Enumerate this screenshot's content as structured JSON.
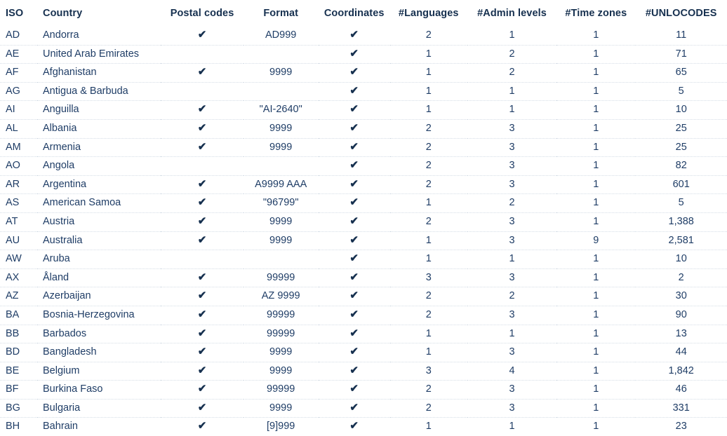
{
  "table": {
    "columns": [
      {
        "key": "iso",
        "label": "ISO"
      },
      {
        "key": "country",
        "label": "Country"
      },
      {
        "key": "postal",
        "label": "Postal codes"
      },
      {
        "key": "format",
        "label": "Format"
      },
      {
        "key": "coords",
        "label": "Coordinates"
      },
      {
        "key": "langs",
        "label": "#Languages"
      },
      {
        "key": "admin",
        "label": "#Admin levels"
      },
      {
        "key": "tz",
        "label": "#Time zones"
      },
      {
        "key": "unlo",
        "label": "#UNLOCODES"
      }
    ],
    "check_glyph": "✔",
    "header_color": "#16304f",
    "text_color": "#1f3d66",
    "rule_color": "#d5dde6",
    "rows": [
      {
        "iso": "AD",
        "country": "Andorra",
        "postal": true,
        "format": "AD999",
        "coords": true,
        "langs": "2",
        "admin": "1",
        "tz": "1",
        "unlo": "11"
      },
      {
        "iso": "AE",
        "country": "United Arab Emirates",
        "postal": false,
        "format": "",
        "coords": true,
        "langs": "1",
        "admin": "2",
        "tz": "1",
        "unlo": "71"
      },
      {
        "iso": "AF",
        "country": "Afghanistan",
        "postal": true,
        "format": "9999",
        "coords": true,
        "langs": "1",
        "admin": "2",
        "tz": "1",
        "unlo": "65"
      },
      {
        "iso": "AG",
        "country": "Antigua & Barbuda",
        "postal": false,
        "format": "",
        "coords": true,
        "langs": "1",
        "admin": "1",
        "tz": "1",
        "unlo": "5"
      },
      {
        "iso": "AI",
        "country": "Anguilla",
        "postal": true,
        "format": "\"AI-2640\"",
        "coords": true,
        "langs": "1",
        "admin": "1",
        "tz": "1",
        "unlo": "10"
      },
      {
        "iso": "AL",
        "country": "Albania",
        "postal": true,
        "format": "9999",
        "coords": true,
        "langs": "2",
        "admin": "3",
        "tz": "1",
        "unlo": "25"
      },
      {
        "iso": "AM",
        "country": "Armenia",
        "postal": true,
        "format": "9999",
        "coords": true,
        "langs": "2",
        "admin": "3",
        "tz": "1",
        "unlo": "25"
      },
      {
        "iso": "AO",
        "country": "Angola",
        "postal": false,
        "format": "",
        "coords": true,
        "langs": "2",
        "admin": "3",
        "tz": "1",
        "unlo": "82"
      },
      {
        "iso": "AR",
        "country": "Argentina",
        "postal": true,
        "format": "A9999 AAA",
        "coords": true,
        "langs": "2",
        "admin": "3",
        "tz": "1",
        "unlo": "601"
      },
      {
        "iso": "AS",
        "country": "American Samoa",
        "postal": true,
        "format": "\"96799\"",
        "coords": true,
        "langs": "1",
        "admin": "2",
        "tz": "1",
        "unlo": "5"
      },
      {
        "iso": "AT",
        "country": "Austria",
        "postal": true,
        "format": "9999",
        "coords": true,
        "langs": "2",
        "admin": "3",
        "tz": "1",
        "unlo": "1,388"
      },
      {
        "iso": "AU",
        "country": "Australia",
        "postal": true,
        "format": "9999",
        "coords": true,
        "langs": "1",
        "admin": "3",
        "tz": "9",
        "unlo": "2,581"
      },
      {
        "iso": "AW",
        "country": "Aruba",
        "postal": false,
        "format": "",
        "coords": true,
        "langs": "1",
        "admin": "1",
        "tz": "1",
        "unlo": "10"
      },
      {
        "iso": "AX",
        "country": "Åland",
        "postal": true,
        "format": "99999",
        "coords": true,
        "langs": "3",
        "admin": "3",
        "tz": "1",
        "unlo": "2"
      },
      {
        "iso": "AZ",
        "country": "Azerbaijan",
        "postal": true,
        "format": "AZ 9999",
        "coords": true,
        "langs": "2",
        "admin": "2",
        "tz": "1",
        "unlo": "30"
      },
      {
        "iso": "BA",
        "country": "Bosnia-Herzegovina",
        "postal": true,
        "format": "99999",
        "coords": true,
        "langs": "2",
        "admin": "3",
        "tz": "1",
        "unlo": "90"
      },
      {
        "iso": "BB",
        "country": "Barbados",
        "postal": true,
        "format": "99999",
        "coords": true,
        "langs": "1",
        "admin": "1",
        "tz": "1",
        "unlo": "13"
      },
      {
        "iso": "BD",
        "country": "Bangladesh",
        "postal": true,
        "format": "9999",
        "coords": true,
        "langs": "1",
        "admin": "3",
        "tz": "1",
        "unlo": "44"
      },
      {
        "iso": "BE",
        "country": "Belgium",
        "postal": true,
        "format": "9999",
        "coords": true,
        "langs": "3",
        "admin": "4",
        "tz": "1",
        "unlo": "1,842"
      },
      {
        "iso": "BF",
        "country": "Burkina Faso",
        "postal": true,
        "format": "99999",
        "coords": true,
        "langs": "2",
        "admin": "3",
        "tz": "1",
        "unlo": "46"
      },
      {
        "iso": "BG",
        "country": "Bulgaria",
        "postal": true,
        "format": "9999",
        "coords": true,
        "langs": "2",
        "admin": "3",
        "tz": "1",
        "unlo": "331"
      },
      {
        "iso": "BH",
        "country": "Bahrain",
        "postal": true,
        "format": "[9]999",
        "coords": true,
        "langs": "1",
        "admin": "1",
        "tz": "1",
        "unlo": "23"
      }
    ]
  }
}
